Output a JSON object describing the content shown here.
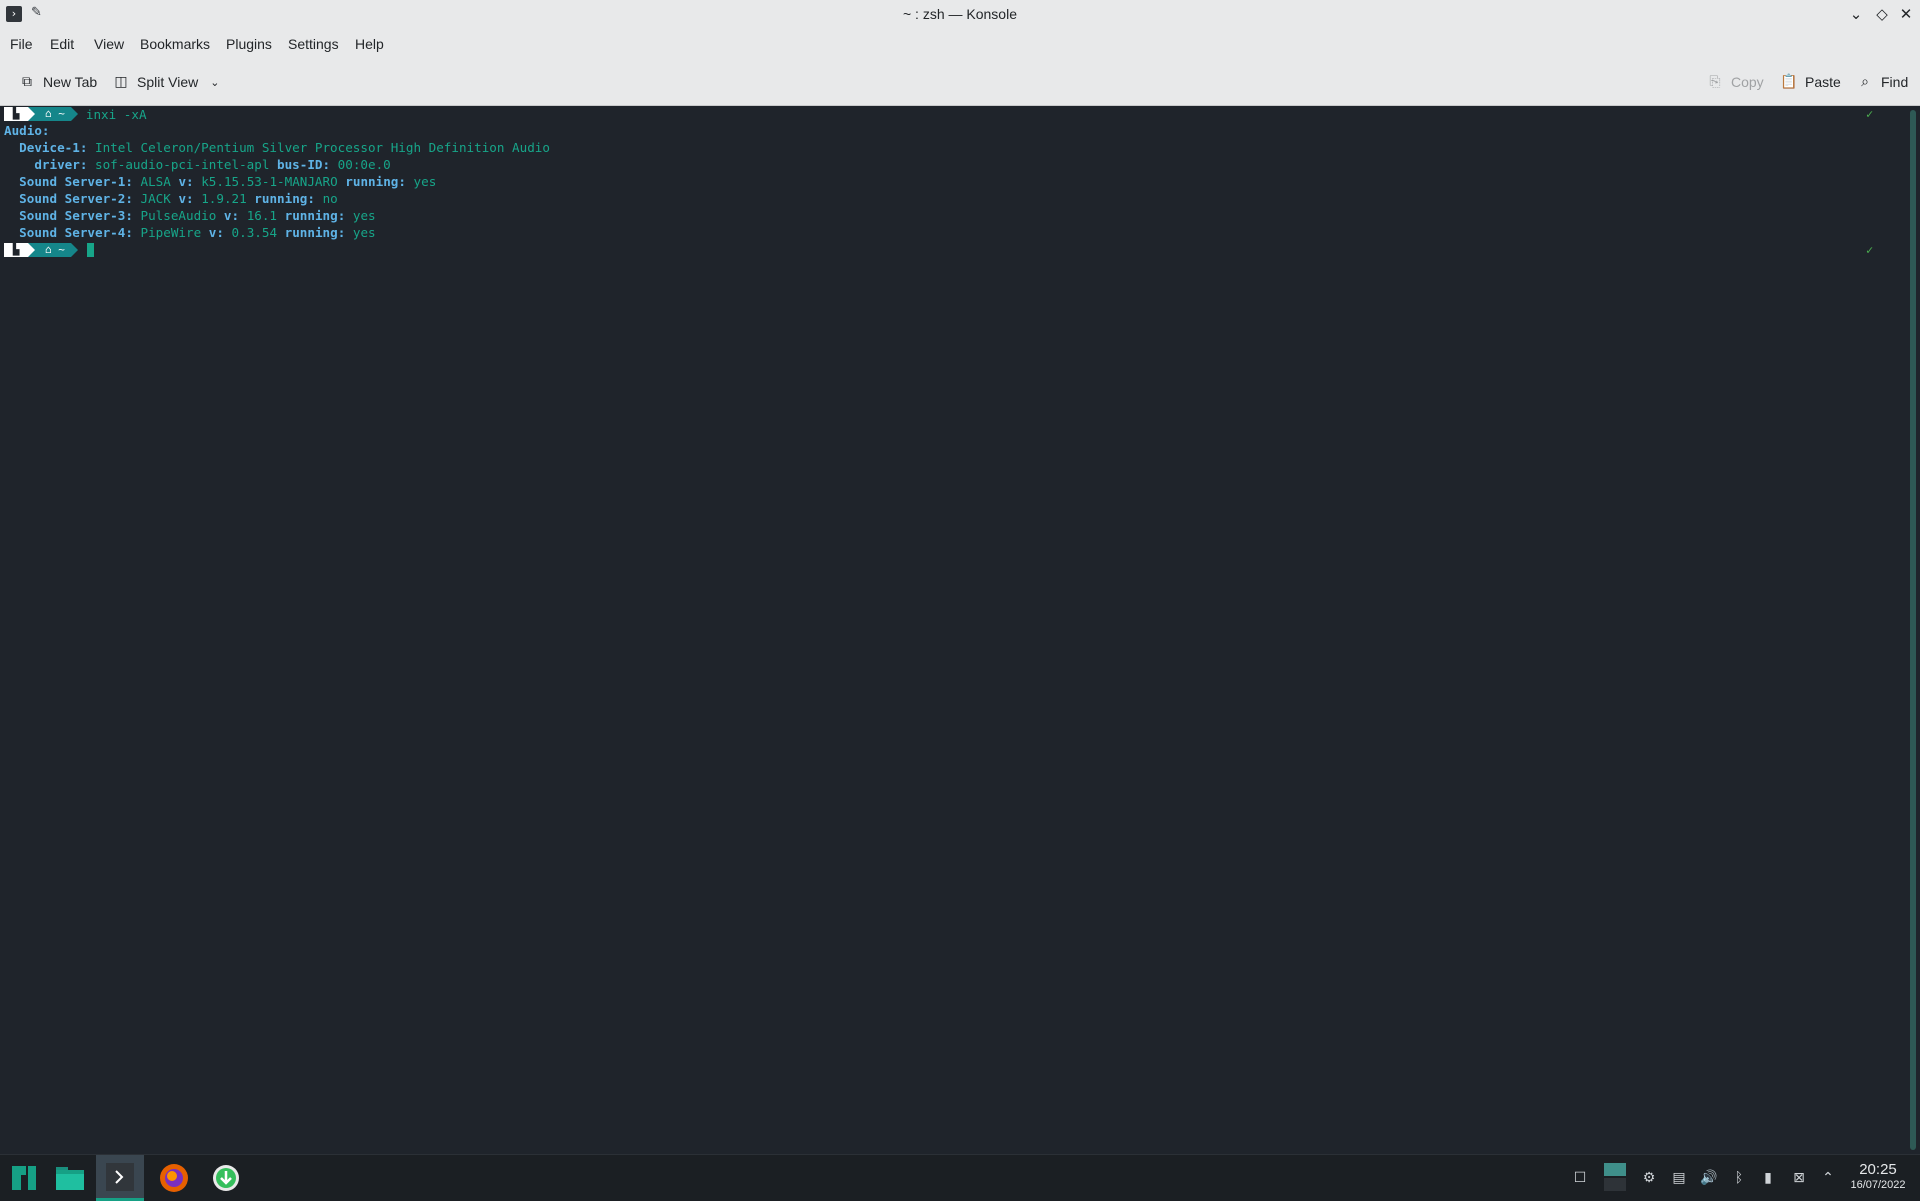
{
  "window": {
    "title": "~ : zsh — Konsole"
  },
  "menu": [
    "File",
    "Edit",
    "View",
    "Bookmarks",
    "Plugins",
    "Settings",
    "Help"
  ],
  "toolbar": {
    "new_tab": "New Tab",
    "split_view": "Split View",
    "copy": "Copy",
    "paste": "Paste",
    "find": "Find"
  },
  "terminal": {
    "prompt_home": "~",
    "command": "inxi -xA",
    "lines": {
      "audio_heading": "Audio:",
      "device1_key": "Device-1:",
      "device1_val": "Intel Celeron/Pentium Silver Processor High Definition Audio",
      "driver_key": "driver:",
      "driver_val": "sof-audio-pci-intel-apl",
      "busid_key": "bus-ID:",
      "busid_val": "00:0e.0",
      "ss1_key": "Sound Server-1:",
      "ss1_name": "ALSA",
      "ss1_v": "k5.15.53-1-MANJARO",
      "ss1_run": "yes",
      "ss2_key": "Sound Server-2:",
      "ss2_name": "JACK",
      "ss2_v": "1.9.21",
      "ss2_run": "no",
      "ss3_key": "Sound Server-3:",
      "ss3_name": "PulseAudio",
      "ss3_v": "16.1",
      "ss3_run": "yes",
      "ss4_key": "Sound Server-4:",
      "ss4_name": "PipeWire",
      "ss4_v": "0.3.54",
      "ss4_run": "yes",
      "v_key": "v:",
      "running_key": "running:"
    },
    "status_mark": "✓"
  },
  "taskbar": {
    "time": "20:25",
    "date": "16/07/2022"
  },
  "colors": {
    "accent": "#16a085",
    "terminal_bg": "#1f242b",
    "key_blue": "#5fb3e6",
    "value_green": "#17a589"
  }
}
